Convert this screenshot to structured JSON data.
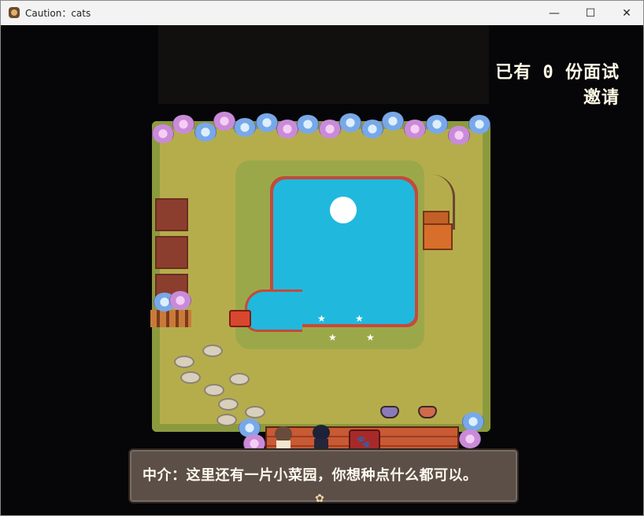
{
  "window": {
    "title": "Caution：cats",
    "app_icon": "game-icon",
    "controls": {
      "minimize_icon": "—",
      "maximize_icon": "☐",
      "close_icon": "✕"
    }
  },
  "hud": {
    "invites_counter": "已有 0 份面试邀请"
  },
  "dialog": {
    "text": "中介：这里还有一片小菜园，你想种点什么都可以。",
    "continue_icon": "✿"
  },
  "colors": {
    "grass": "#b5ad4c",
    "pond": "#21b8dd",
    "pond_rim": "#c44a3a",
    "dialog_bg": "#5b4f48",
    "deck": "#c85a34"
  }
}
